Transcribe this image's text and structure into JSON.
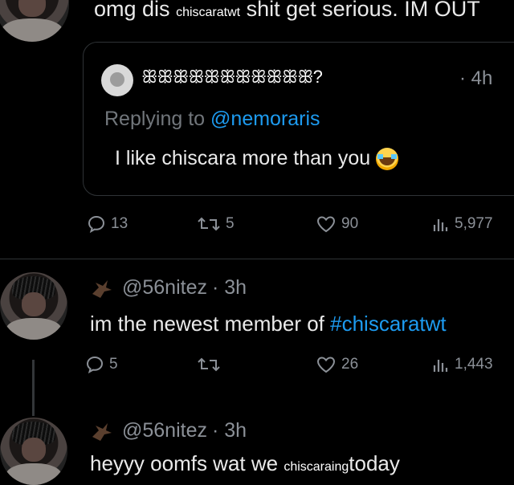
{
  "top_tweet": {
    "text_before": "omg dis",
    "overlay_word": "chiscaratwt",
    "text_after": "shit get serious. IM OUT"
  },
  "quoted_tweet": {
    "display_name": "ꕥꕥꕥꕥꕥꕥꕥꕥꕥꕥꕥ?",
    "time": "· 4h",
    "replying_prefix": "Replying to ",
    "replying_handle": "@nemoraris",
    "text": "I like chiscara more than you",
    "emoji": "crying-face-emoji"
  },
  "top_stats": {
    "replies": "13",
    "retweets": "5",
    "likes": "90",
    "views": "5,977"
  },
  "reply1": {
    "handle": "@56nitez",
    "time": "· 3h",
    "text_before": "im the newest member of ",
    "hashtag": "#chiscaratwt",
    "stats": {
      "replies": "5",
      "retweets": "",
      "likes": "26",
      "views": "1,443"
    }
  },
  "reply2": {
    "handle": "@56nitez",
    "time": "· 3h",
    "text_before": "heyyy oomfs wat we",
    "overlay_word": "chiscaraing",
    "text_after": "today"
  },
  "colors": {
    "background": "#000000",
    "text": "#e7e9ea",
    "muted": "#71767b",
    "link": "#1d9bf0"
  }
}
